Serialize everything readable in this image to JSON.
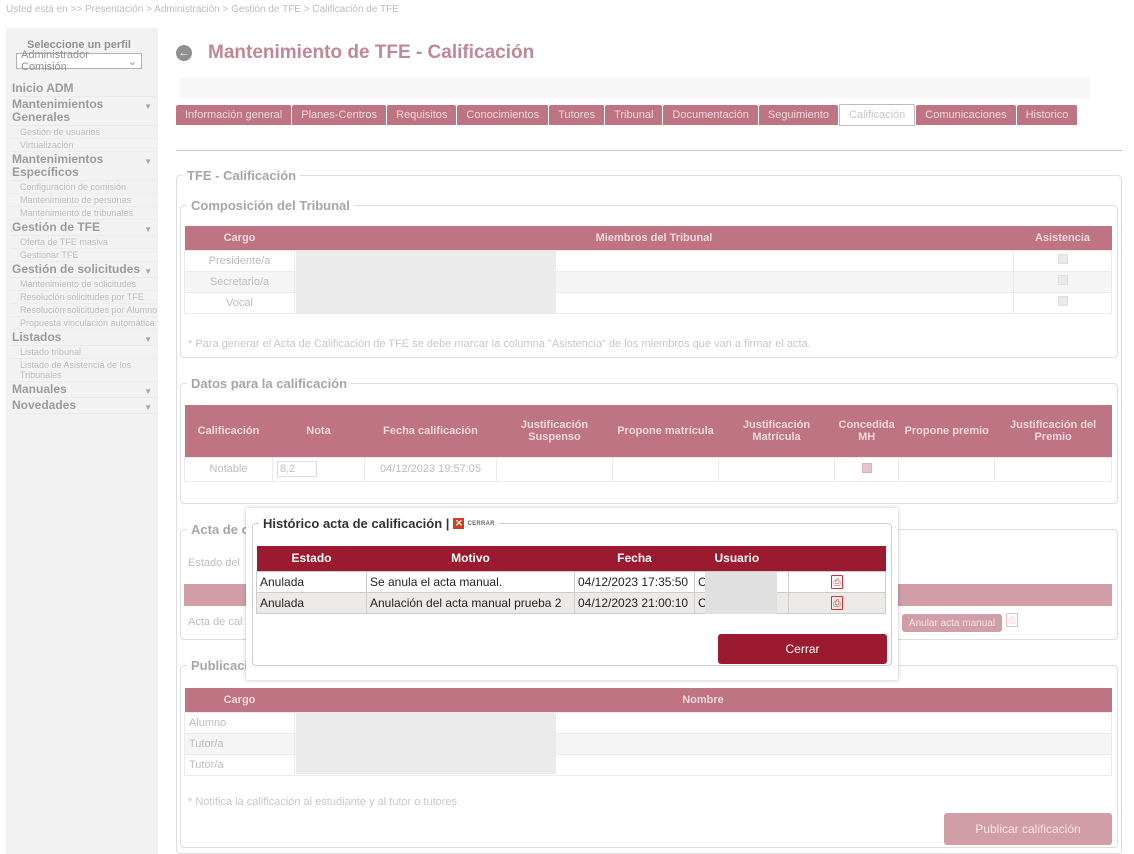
{
  "breadcrumb": "Usted está en >> Presentación > Administración > Gestión de TFE > Calificación de TFE",
  "profile": {
    "title": "Seleccione un perfil",
    "selected": "Administrador Comisión"
  },
  "menu": [
    {
      "label": "Inicio ADM",
      "items": []
    },
    {
      "label": "Mantenimientos Generales",
      "items": [
        "Gestión de usuarios",
        "Virtualización"
      ]
    },
    {
      "label": "Mantenimientos Específicos",
      "items": [
        "Configuración de comisión",
        "Mantenimiento de personas",
        "Mantenimiento de tribunales"
      ]
    },
    {
      "label": "Gestión de TFE",
      "items": [
        "Oferta de TFE masiva",
        "Gestionar TFE"
      ]
    },
    {
      "label": "Gestión de solicitudes",
      "items": [
        "Mantenimiento de solicitudes",
        "Resolución solicitudes por TFE",
        "Resolución solicitudes por Alumno",
        "Propuesta vinculación automática"
      ]
    },
    {
      "label": "Listados",
      "items": [
        "Listado tribunal",
        "Listado de Asistencia de los Tribunales"
      ]
    },
    {
      "label": "Manuales",
      "items": []
    },
    {
      "label": "Novedades",
      "items": []
    }
  ],
  "page_title": "Mantenimiento de TFE - Calificación",
  "tabs": [
    "Información general",
    "Planes-Centros",
    "Requisitos",
    "Conocimientos",
    "Tutores",
    "Tribunal",
    "Documentación",
    "Seguimiento",
    "Calificación",
    "Comunicaciones",
    "Historico"
  ],
  "active_tab": "Calificación",
  "section_main": "TFE - Calificación",
  "tribunal": {
    "legend": "Composición del Tribunal",
    "headers": [
      "Cargo",
      "Miembros del Tribunal",
      "Asistencia"
    ],
    "rows": [
      "Presidente/a",
      "Secretario/a",
      "Vocal"
    ],
    "note": "* Para generar el Acta de Calificación de TFE se debe marcar la columna \"Asistencia\" de los miembros que van a firmar el acta."
  },
  "datos": {
    "legend": "Datos para la calificación",
    "headers": [
      "Calificación",
      "Nota",
      "Fecha calificación",
      "Justificación Suspenso",
      "Propone matrícula",
      "Justificación Matrícula",
      "Concedida MH",
      "Propone premio",
      "Justificación del Premio"
    ],
    "row": {
      "calificacion": "Notable",
      "nota": "8,2",
      "fecha": "04/12/2023 19:57:05"
    }
  },
  "acta": {
    "legend": "Acta de c",
    "estado_label": "Estado del",
    "acta_label": "Acta de cal",
    "anular_label": "Anular acta manual"
  },
  "publicacion": {
    "legend": "Publicaci",
    "headers": [
      "Cargo",
      "Nombre"
    ],
    "rows": [
      "Alumno",
      "Tutor/a",
      "Tutor/a"
    ],
    "note": "* Notifica la calificación al estudiante y al tutor o tutores",
    "button": "Publicar calificación"
  },
  "modal": {
    "title": "Histórico acta de calificación |",
    "close_small": "CERRAR",
    "headers": [
      "Estado",
      "Motivo",
      "Fecha",
      "Usuario",
      ""
    ],
    "rows": [
      {
        "estado": "Anulada",
        "motivo": "Se anula el acta manual.",
        "fecha": "04/12/2023 17:35:50",
        "usuario": "C"
      },
      {
        "estado": "Anulada",
        "motivo": "Anulación del acta manual prueba 2",
        "fecha": "04/12/2023 21:00:10",
        "usuario": "C"
      }
    ],
    "button": "Cerrar"
  }
}
